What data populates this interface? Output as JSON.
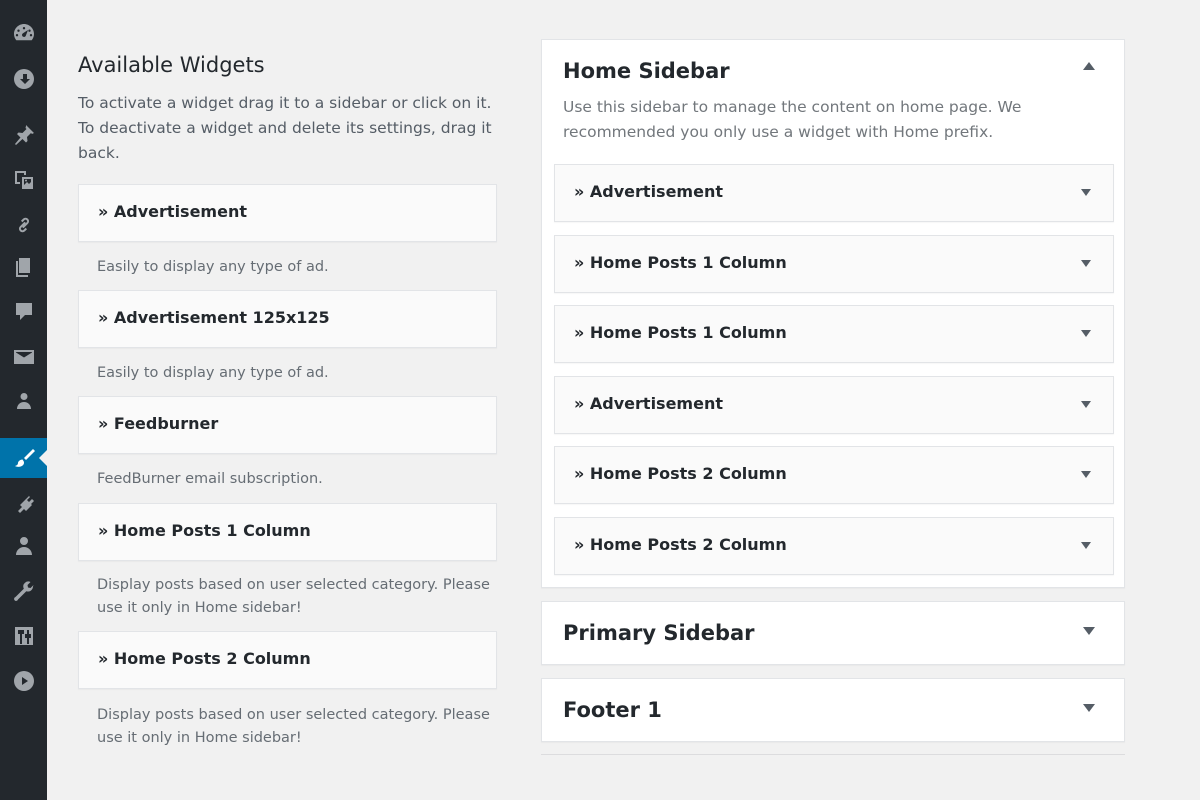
{
  "admin_menu": {
    "items": [
      {
        "icon": "dashboard-icon"
      },
      {
        "icon": "updates-icon"
      },
      {
        "icon": "pin-icon"
      },
      {
        "icon": "media-icon"
      },
      {
        "icon": "link-icon"
      },
      {
        "icon": "pages-icon"
      },
      {
        "icon": "comments-icon"
      },
      {
        "icon": "mail-icon"
      },
      {
        "icon": "users-group-icon"
      },
      {
        "icon": "appearance-brush-icon"
      },
      {
        "icon": "plugins-icon"
      },
      {
        "icon": "user-icon"
      },
      {
        "icon": "tools-wrench-icon"
      },
      {
        "icon": "settings-icon"
      },
      {
        "icon": "play-icon"
      }
    ],
    "current": "appearance-brush-icon",
    "accent": "#0073aa"
  },
  "available": {
    "title": "Available Widgets",
    "description": "To activate a widget drag it to a sidebar or click on it. To deactivate a widget and delete its settings, drag it back.",
    "widgets": [
      {
        "title": "» Advertisement",
        "description": "Easily to display any type of ad."
      },
      {
        "title": "» Advertisement 125x125",
        "description": "Easily to display any type of ad."
      },
      {
        "title": "» Feedburner",
        "description": "FeedBurner email subscription."
      },
      {
        "title": "» Home Posts 1 Column",
        "description": "Display posts based on user selected category. Please use it only in Home sidebar!"
      },
      {
        "title": "» Home Posts 2 Column",
        "description": "Display posts based on user selected category. Please use it only in Home sidebar!"
      }
    ]
  },
  "sidebars": {
    "home": {
      "title": "Home Sidebar",
      "description": "Use this sidebar to manage the content on home page. We recommended you only use a widget with Home prefix.",
      "widgets": [
        {
          "title": "» Advertisement"
        },
        {
          "title": "» Home Posts 1 Column"
        },
        {
          "title": "» Home Posts 1 Column"
        },
        {
          "title": "» Advertisement"
        },
        {
          "title": "» Home Posts 2 Column"
        },
        {
          "title": "» Home Posts 2 Column"
        }
      ]
    },
    "primary": {
      "title": "Primary Sidebar"
    },
    "footer1": {
      "title": "Footer 1"
    }
  }
}
